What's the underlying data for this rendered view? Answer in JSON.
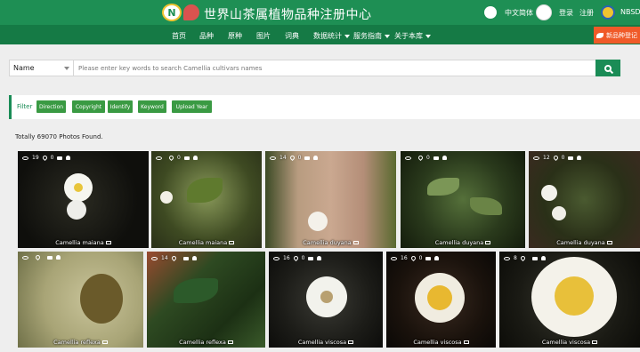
{
  "header": {
    "title": "世界山茶属植物品种注册中心",
    "language": "中文简体",
    "login": "登录",
    "register": "注册",
    "org": "NBSDC"
  },
  "nav": {
    "items": [
      "首页",
      "品种",
      "原种",
      "图片",
      "词典",
      "数据统计",
      "服务指南",
      "关于本库"
    ],
    "register_button": "新品种登记"
  },
  "search": {
    "field_selected": "Name",
    "placeholder": "Please enter key words to search Camellia cultivars names"
  },
  "filter": {
    "label": "Filter",
    "buttons": [
      "Direction",
      "Copyright",
      "Identify",
      "Keyword",
      "Upload Year"
    ]
  },
  "results": {
    "prefix": "Totally",
    "count": "69070",
    "suffix": "Photos Found."
  },
  "photos": [
    {
      "caption": "Camellia maiana",
      "views": "19",
      "likes": "0"
    },
    {
      "caption": "Camellia maiana",
      "views": "",
      "likes": "0"
    },
    {
      "caption": "Camellia duyana",
      "views": "14",
      "likes": "0"
    },
    {
      "caption": "Camellia duyana",
      "views": "",
      "likes": "0"
    },
    {
      "caption": "Camellia duyana",
      "views": "12",
      "likes": "0"
    },
    {
      "caption": "Camellia reflexa",
      "views": "",
      "likes": ""
    },
    {
      "caption": "Camellia reflexa",
      "views": "14",
      "likes": ""
    },
    {
      "caption": "Camellia viscosa",
      "views": "16",
      "likes": "0"
    },
    {
      "caption": "Camellia viscosa",
      "views": "16",
      "likes": "0"
    },
    {
      "caption": "Camellia viscosa",
      "views": "8",
      "likes": ""
    }
  ]
}
